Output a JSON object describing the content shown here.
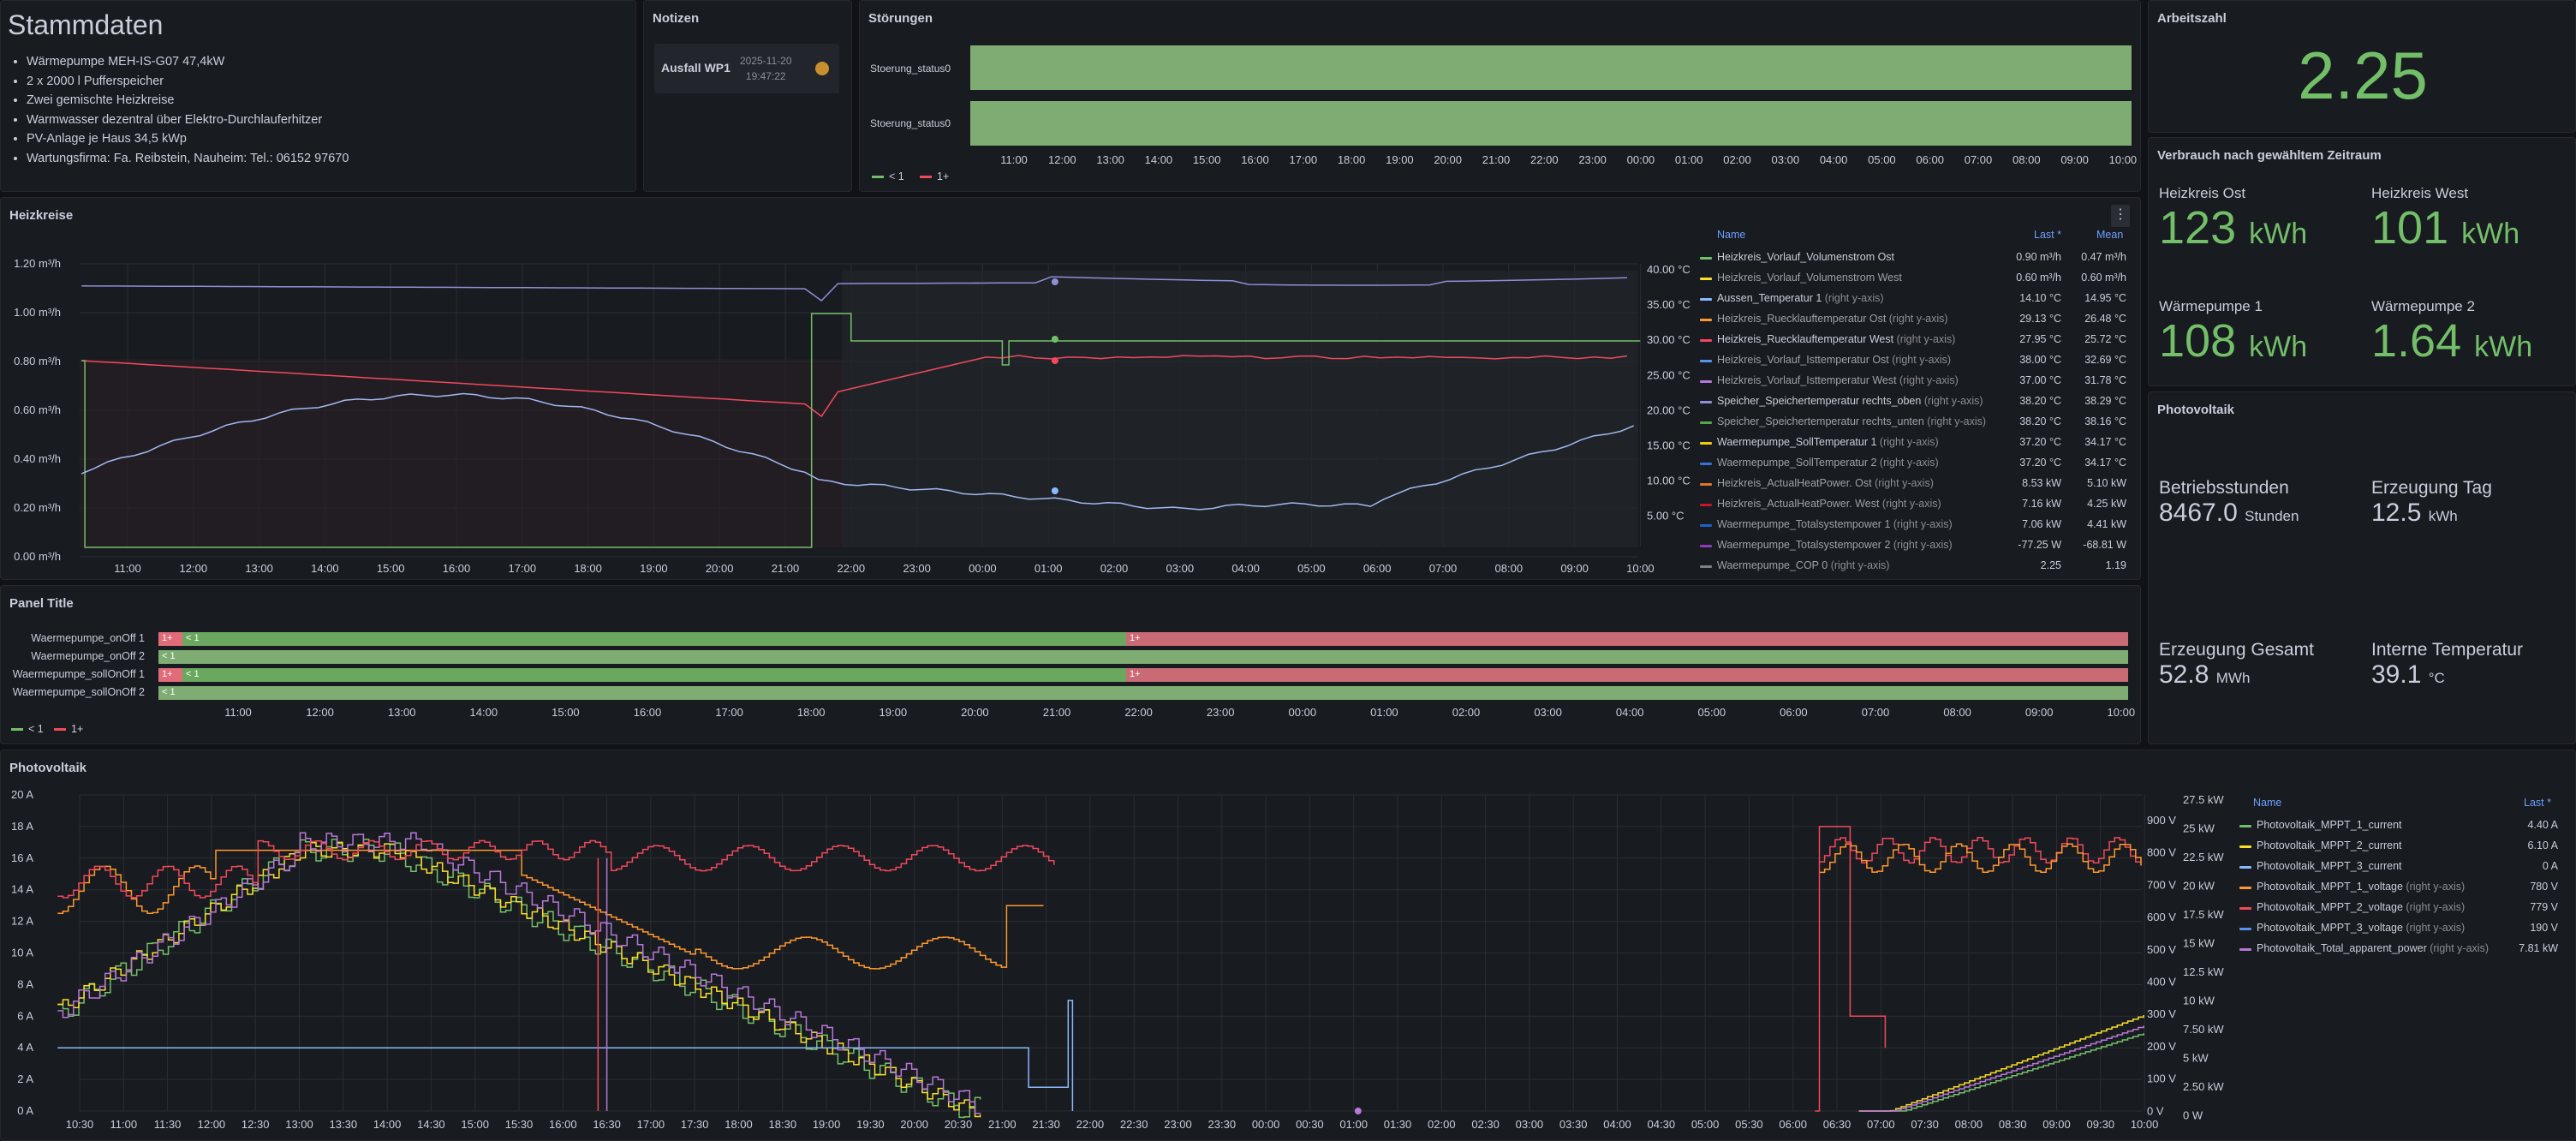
{
  "stammdaten": {
    "title": "Stammdaten",
    "items": [
      "Wärmepumpe MEH-IS-G07 47,4kW",
      "2 x 2000 l Pufferspeicher",
      "Zwei gemischte Heizkreise",
      "Warmwasser dezentral über Elektro-Durchlauferhitzer",
      "PV-Anlage je Haus 34,5 kWp",
      "Wartungsfirma: Fa. Reibstein, Nauheim: Tel.: 06152 97670"
    ]
  },
  "notizen": {
    "title": "Notizen",
    "note_title": "Ausfall WP1",
    "note_date": "2025-11-20",
    "note_time": "19:47:22",
    "avatar": "user-avatar-icon"
  },
  "stoerungen": {
    "title": "Störungen",
    "rows": [
      "Stoerung_status0",
      "Stoerung_status0"
    ],
    "ticks": [
      "11:00",
      "12:00",
      "13:00",
      "14:00",
      "15:00",
      "16:00",
      "17:00",
      "18:00",
      "19:00",
      "20:00",
      "21:00",
      "22:00",
      "23:00",
      "00:00",
      "01:00",
      "02:00",
      "03:00",
      "04:00",
      "05:00",
      "06:00",
      "07:00",
      "08:00",
      "09:00",
      "10:00"
    ],
    "legend": [
      "< 1",
      "1+"
    ]
  },
  "arbeitszahl": {
    "title": "Arbeitszahl",
    "value": "2.25"
  },
  "verbrauch": {
    "title": "Verbrauch nach gewähltem Zeitraum",
    "stats": [
      {
        "label": "Heizkreis Ost",
        "value": "123",
        "unit": "kWh"
      },
      {
        "label": "Heizkreis West",
        "value": "101",
        "unit": "kWh"
      },
      {
        "label": "Wärmepumpe 1",
        "value": "108",
        "unit": "kWh"
      },
      {
        "label": "Wärmepumpe 2",
        "value": "1.64",
        "unit": "kWh"
      }
    ]
  },
  "photovoltaik_stats": {
    "title": "Photovoltaik",
    "stats": [
      {
        "label": "Betriebsstunden",
        "value": "8467.0",
        "unit": "Stunden"
      },
      {
        "label": "Erzeugung Tag",
        "value": "12.5",
        "unit": "kWh"
      },
      {
        "label": "Erzeugung Gesamt",
        "value": "52.8",
        "unit": "MWh"
      },
      {
        "label": "Interne Temperatur",
        "value": "39.1",
        "unit": "°C"
      }
    ]
  },
  "heizkreise": {
    "title": "Heizkreise",
    "menu": "⋮",
    "y_left": [
      "1.20 m³/h",
      "1.00 m³/h",
      "0.80 m³/h",
      "0.60 m³/h",
      "0.40 m³/h",
      "0.20 m³/h",
      "0.00 m³/h"
    ],
    "y_right": [
      "40.00 °C",
      "35.00 °C",
      "30.00 °C",
      "25.00 °C",
      "20.00 °C",
      "15.00 °C",
      "10.00 °C",
      "5.00 °C"
    ],
    "x": [
      "11:00",
      "12:00",
      "13:00",
      "14:00",
      "15:00",
      "16:00",
      "17:00",
      "18:00",
      "19:00",
      "20:00",
      "21:00",
      "22:00",
      "23:00",
      "00:00",
      "01:00",
      "02:00",
      "03:00",
      "04:00",
      "05:00",
      "06:00",
      "07:00",
      "08:00",
      "09:00",
      "10:00"
    ],
    "legend_header": {
      "name": "Name",
      "last": "Last *",
      "mean": "Mean"
    },
    "legend": [
      {
        "name": "Heizkreis_Vorlauf_Volumenstrom Ost",
        "suffix": "",
        "last": "0.90 m³/h",
        "mean": "0.47 m³/h",
        "color": "#73bf69",
        "dim": false
      },
      {
        "name": "Heizkreis_Vorlauf_Volumenstrom West",
        "suffix": "",
        "last": "0.60 m³/h",
        "mean": "0.60 m³/h",
        "color": "#fade2a",
        "dim": true
      },
      {
        "name": "Aussen_Temperatur 1",
        "suffix": " (right y-axis)",
        "last": "14.10 °C",
        "mean": "14.95 °C",
        "color": "#8ab8ff",
        "dim": false
      },
      {
        "name": "Heizkreis_Ruecklauftemperatur Ost",
        "suffix": " (right y-axis)",
        "last": "29.13 °C",
        "mean": "26.48 °C",
        "color": "#ff9830",
        "dim": true
      },
      {
        "name": "Heizkreis_Ruecklauftemperatur West",
        "suffix": " (right y-axis)",
        "last": "27.95 °C",
        "mean": "25.72 °C",
        "color": "#f2495c",
        "dim": false
      },
      {
        "name": "Heizkreis_Vorlauf_Isttemperatur Ost",
        "suffix": " (right y-axis)",
        "last": "38.00 °C",
        "mean": "32.69 °C",
        "color": "#5794f2",
        "dim": true
      },
      {
        "name": "Heizkreis_Vorlauf_Isttemperatur West",
        "suffix": " (right y-axis)",
        "last": "37.00 °C",
        "mean": "31.78 °C",
        "color": "#b877d9",
        "dim": true
      },
      {
        "name": "Speicher_Speichertemperatur rechts_oben",
        "suffix": " (right y-axis)",
        "last": "38.20 °C",
        "mean": "38.29 °C",
        "color": "#8f8fd6",
        "dim": false
      },
      {
        "name": "Speicher_Speichertemperatur rechts_unten",
        "suffix": " (right y-axis)",
        "last": "38.20 °C",
        "mean": "38.16 °C",
        "color": "#56a64b",
        "dim": true
      },
      {
        "name": "Waermepumpe_SollTemperatur 1",
        "suffix": " (right y-axis)",
        "last": "37.20 °C",
        "mean": "34.17 °C",
        "color": "#f2cc0c",
        "dim": false
      },
      {
        "name": "Waermepumpe_SollTemperatur 2",
        "suffix": " (right y-axis)",
        "last": "37.20 °C",
        "mean": "34.17 °C",
        "color": "#3274d9",
        "dim": true
      },
      {
        "name": "Heizkreis_ActualHeatPower. Ost",
        "suffix": " (right y-axis)",
        "last": "8.53 kW",
        "mean": "5.10 kW",
        "color": "#e0752d",
        "dim": true
      },
      {
        "name": "Heizkreis_ActualHeatPower. West",
        "suffix": " (right y-axis)",
        "last": "7.16 kW",
        "mean": "4.25 kW",
        "color": "#c4162a",
        "dim": true
      },
      {
        "name": "Waermepumpe_Totalsystempower 1",
        "suffix": " (right y-axis)",
        "last": "7.06 kW",
        "mean": "4.41 kW",
        "color": "#1f60c4",
        "dim": true
      },
      {
        "name": "Waermepumpe_Totalsystempower 2",
        "suffix": " (right y-axis)",
        "last": "-77.25 W",
        "mean": "-68.81 W",
        "color": "#8f3bb8",
        "dim": true
      },
      {
        "name": "Waermepumpe_COP 0",
        "suffix": " (right y-axis)",
        "last": "2.25",
        "mean": "1.19",
        "color": "#808080",
        "dim": true
      }
    ]
  },
  "panel_title": {
    "title": "Panel Title",
    "rows": [
      "Waermepumpe_onOff 1",
      "Waermepumpe_onOff 2",
      "Waermepumpe_sollOnOff 1",
      "Waermepumpe_sollOnOff 2"
    ],
    "x": [
      "11:00",
      "12:00",
      "13:00",
      "14:00",
      "15:00",
      "16:00",
      "17:00",
      "18:00",
      "19:00",
      "20:00",
      "21:00",
      "22:00",
      "23:00",
      "00:00",
      "01:00",
      "02:00",
      "03:00",
      "04:00",
      "05:00",
      "06:00",
      "07:00",
      "08:00",
      "09:00",
      "10:00"
    ],
    "labels_on": "1+",
    "labels_off": "< 1",
    "legend": [
      "< 1",
      "1+"
    ]
  },
  "pv_chart": {
    "title": "Photovoltaik",
    "y_left": [
      "20 A",
      "18 A",
      "16 A",
      "14 A",
      "12 A",
      "10 A",
      "8 A",
      "6 A",
      "4 A",
      "2 A",
      "0 A"
    ],
    "y_mid": [
      "900 V",
      "800 V",
      "700 V",
      "600 V",
      "500 V",
      "400 V",
      "300 V",
      "200 V",
      "100 V",
      "0 V"
    ],
    "y_right": [
      "27.5 kW",
      "25 kW",
      "22.5 kW",
      "20 kW",
      "17.5 kW",
      "15 kW",
      "12.5 kW",
      "10 kW",
      "7.50 kW",
      "5 kW",
      "2.50 kW",
      "0 W"
    ],
    "x": [
      "10:30",
      "11:00",
      "11:30",
      "12:00",
      "12:30",
      "13:00",
      "13:30",
      "14:00",
      "14:30",
      "15:00",
      "15:30",
      "16:00",
      "16:30",
      "17:00",
      "17:30",
      "18:00",
      "18:30",
      "19:00",
      "19:30",
      "20:00",
      "20:30",
      "21:00",
      "21:30",
      "22:00",
      "22:30",
      "23:00",
      "23:30",
      "00:00",
      "00:30",
      "01:00",
      "01:30",
      "02:00",
      "02:30",
      "03:00",
      "03:30",
      "04:00",
      "04:30",
      "05:00",
      "05:30",
      "06:00",
      "06:30",
      "07:00",
      "07:30",
      "08:00",
      "08:30",
      "09:00",
      "09:30",
      "10:00"
    ],
    "legend_header": {
      "name": "Name",
      "last": "Last *"
    },
    "legend": [
      {
        "name": "Photovoltaik_MPPT_1_current",
        "suffix": "",
        "last": "4.40 A",
        "color": "#73bf69"
      },
      {
        "name": "Photovoltaik_MPPT_2_current",
        "suffix": "",
        "last": "6.10 A",
        "color": "#fade2a"
      },
      {
        "name": "Photovoltaik_MPPT_3_current",
        "suffix": "",
        "last": "0 A",
        "color": "#8ab8ff"
      },
      {
        "name": "Photovoltaik_MPPT_1_voltage",
        "suffix": " (right y-axis)",
        "last": "780 V",
        "color": "#ff9830"
      },
      {
        "name": "Photovoltaik_MPPT_2_voltage",
        "suffix": " (right y-axis)",
        "last": "779 V",
        "color": "#f2495c"
      },
      {
        "name": "Photovoltaik_MPPT_3_voltage",
        "suffix": " (right y-axis)",
        "last": "190 V",
        "color": "#5794f2"
      },
      {
        "name": "Photovoltaik_Total_apparent_power",
        "suffix": " (right y-axis)",
        "last": "7.81 kW",
        "color": "#b877d9"
      }
    ]
  }
}
